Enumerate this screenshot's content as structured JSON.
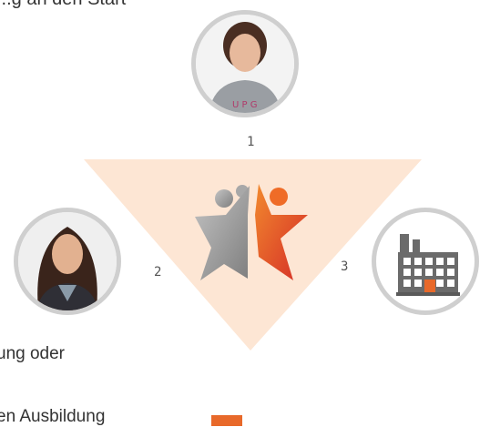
{
  "header": {
    "partial_text": "...g an den Start"
  },
  "nodes": [
    {
      "number": "1",
      "role": "student-girl"
    },
    {
      "number": "2",
      "role": "young-woman"
    },
    {
      "number": "3",
      "role": "company-building"
    }
  ],
  "left_texts": {
    "line1": "ung oder",
    "line2": "en Ausbildung"
  },
  "colors": {
    "triangle": "#fde6d4",
    "accent_orange": "#e8692a",
    "accent_red": "#d7312a",
    "star_grey": "#9a9a9a",
    "circle_border": "#cfcfcf",
    "building_grey": "#6b6b6b"
  }
}
